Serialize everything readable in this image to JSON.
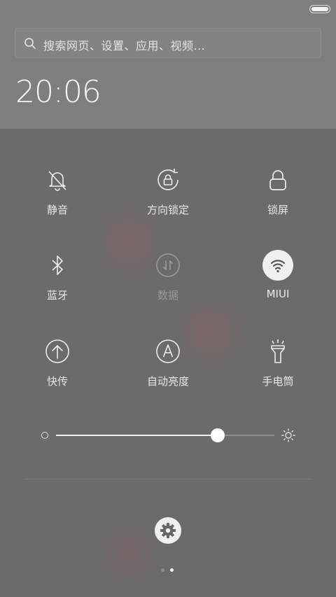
{
  "search": {
    "placeholder": "搜索网页、设置、应用、视频..."
  },
  "clock": {
    "time": "20:06"
  },
  "toggles": [
    {
      "label": "静音",
      "icon": "bell-off-icon"
    },
    {
      "label": "方向锁定",
      "icon": "rotation-lock-icon"
    },
    {
      "label": "锁屏",
      "icon": "lock-icon"
    },
    {
      "label": "蓝牙",
      "icon": "bluetooth-icon"
    },
    {
      "label": "数据",
      "icon": "mobile-data-icon",
      "state": "unavailable"
    },
    {
      "label": "MIUI",
      "icon": "wifi-icon",
      "state": "on"
    },
    {
      "label": "快传",
      "icon": "upload-icon"
    },
    {
      "label": "自动亮度",
      "icon": "auto-brightness-icon"
    },
    {
      "label": "手电筒",
      "icon": "flashlight-icon"
    }
  ],
  "brightness": {
    "level": 0.74
  },
  "pager": {
    "pages": 2,
    "current": 2
  },
  "colors": {
    "panel": "#7e7e7e",
    "background": "#6b6b6b",
    "active": "#f0f0f0"
  }
}
